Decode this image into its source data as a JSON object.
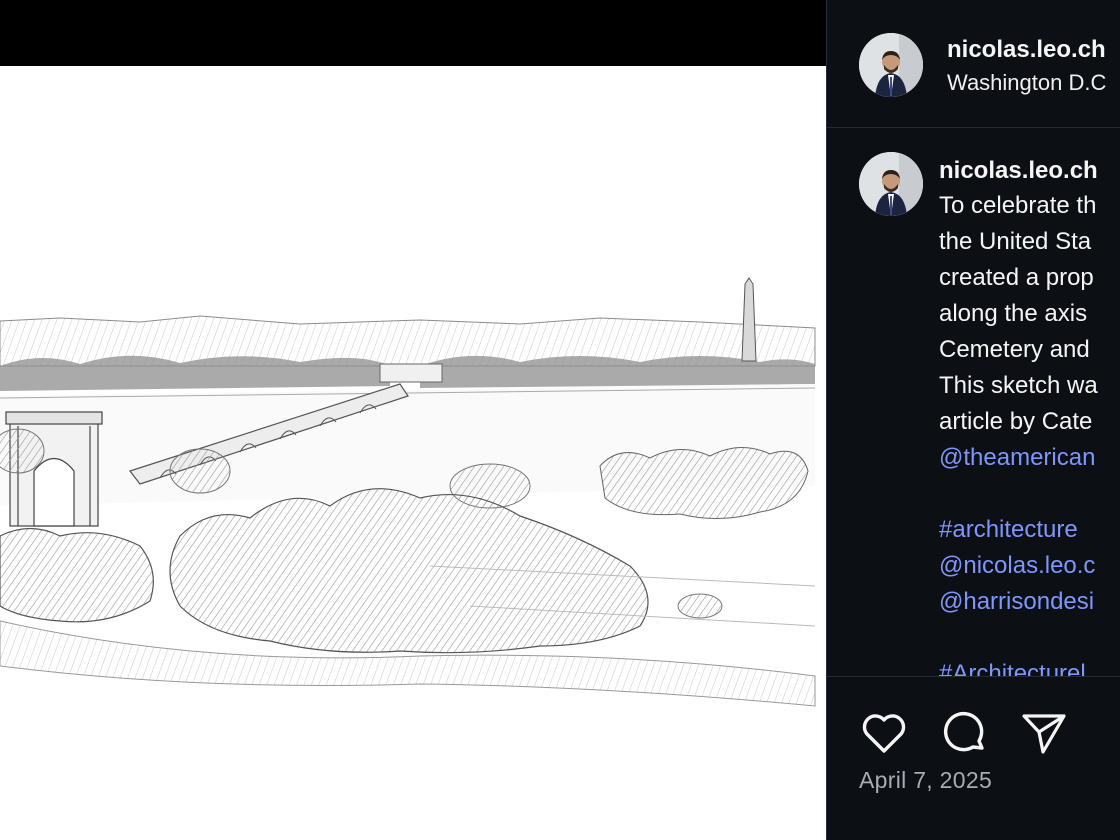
{
  "header": {
    "username": "nicolas.leo.ch",
    "location": "Washington D.C"
  },
  "caption": {
    "username": "nicolas.leo.ch",
    "lines": [
      "To celebrate th",
      "the United Sta",
      "created a prop",
      "along the axis",
      "Cemetery and",
      "This sketch wa",
      "article by Cate"
    ],
    "mention_1": "@theamerican",
    "hashtag_1": "#architecture",
    "mention_2": "@nicolas.leo.c",
    "mention_3": "@harrisondesi",
    "hashtag_2": "#Architecturel"
  },
  "actions": {
    "like_icon": "heart-icon",
    "comment_icon": "comment-icon",
    "share_icon": "paper-plane-icon",
    "date": "April 7, 2025"
  },
  "colors": {
    "background": "#0c0f14",
    "text": "#f5f5f5",
    "link": "#7f96ff",
    "muted": "#a8acb3"
  }
}
